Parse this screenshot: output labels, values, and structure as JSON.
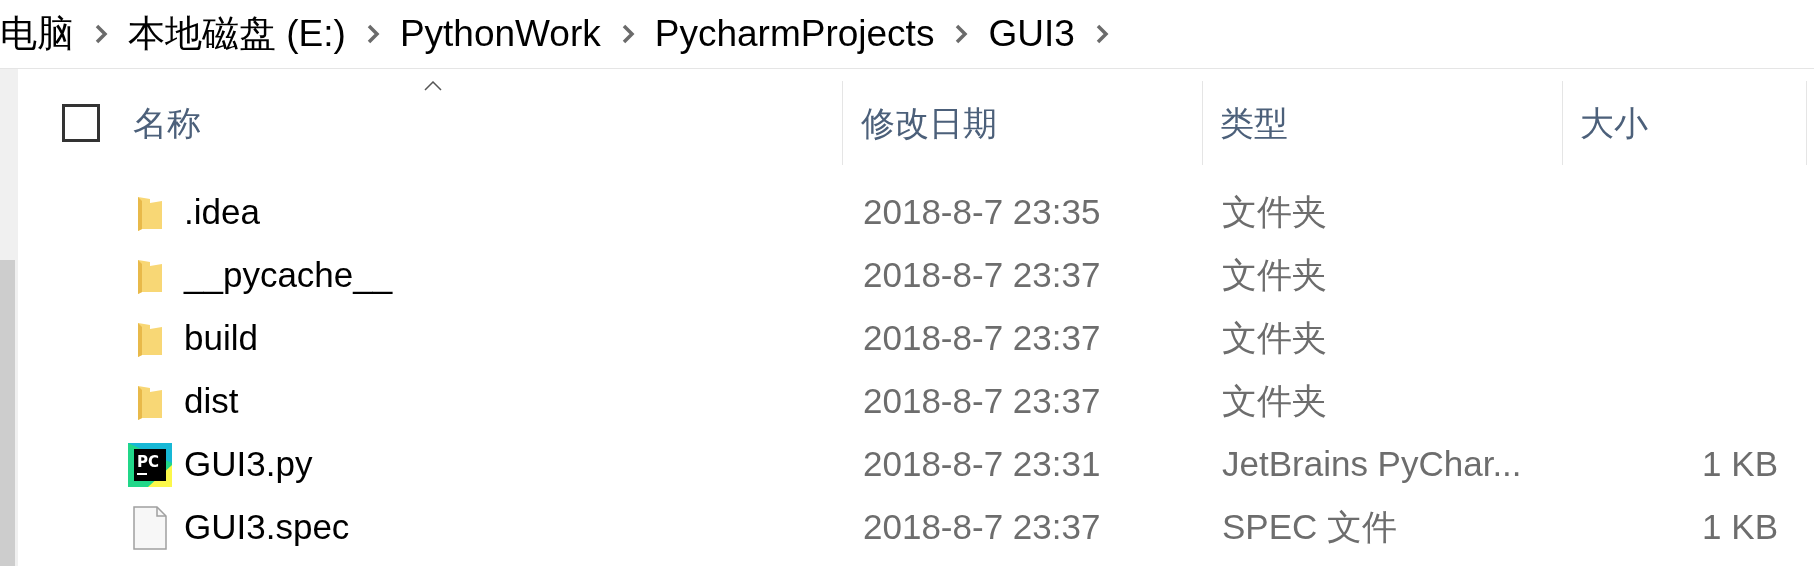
{
  "breadcrumb": [
    "电脑",
    "本地磁盘 (E:)",
    "PythonWork",
    "PycharmProjects",
    "GUI3"
  ],
  "header": {
    "select_all": {
      "checked": false
    },
    "columns": [
      {
        "label": "名称",
        "sorted": true
      },
      {
        "label": "修改日期",
        "sorted": false
      },
      {
        "label": "类型",
        "sorted": false
      },
      {
        "label": "大小",
        "sorted": false
      }
    ]
  },
  "rows": [
    {
      "kind": "folder",
      "name": ".idea",
      "modified": "2018-8-7 23:35",
      "type": "文件夹"
    },
    {
      "kind": "folder",
      "name": "__pycache__",
      "modified": "2018-8-7 23:37",
      "type": "文件夹"
    },
    {
      "kind": "folder",
      "name": "build",
      "modified": "2018-8-7 23:37",
      "type": "文件夹"
    },
    {
      "kind": "folder",
      "name": "dist",
      "modified": "2018-8-7 23:37",
      "type": "文件夹"
    },
    {
      "kind": "pycharm",
      "icon_text": "PC",
      "name": "GUI3.py",
      "modified": "2018-8-7 23:31",
      "type": "JetBrains PyChar...",
      "size": "1 KB"
    },
    {
      "kind": "file",
      "name": "GUI3.spec",
      "modified": "2018-8-7 23:37",
      "type": "SPEC 文件",
      "size": "1 KB"
    }
  ]
}
